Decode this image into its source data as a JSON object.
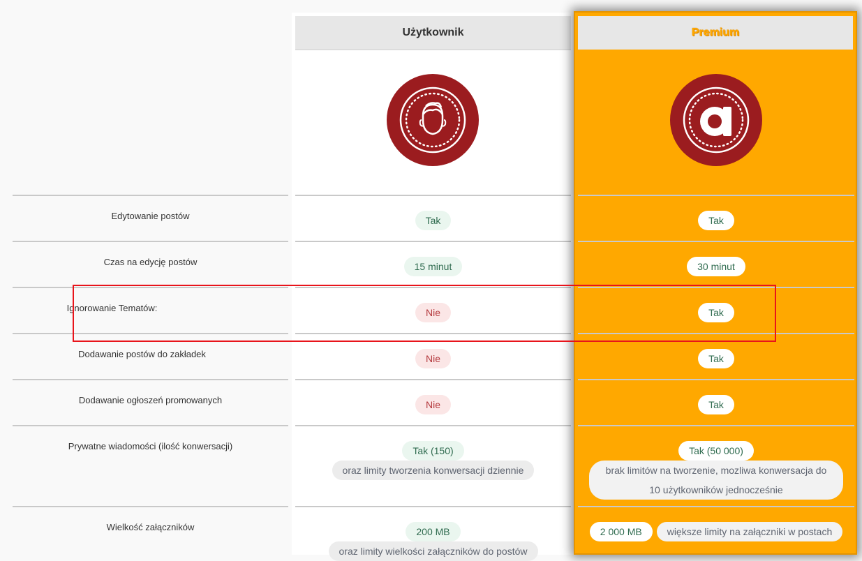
{
  "columns": {
    "user": {
      "title": "Użytkownik",
      "icon": "user-face-icon"
    },
    "premium": {
      "title": "Premium",
      "icon": "letter-a-icon"
    }
  },
  "colors": {
    "premium_bg": "#ffa800",
    "badge_red": "#9b1c1f",
    "yes_text": "#2f6b4f",
    "no_text": "#b4383c",
    "highlight_border": "#e8141b"
  },
  "rows": [
    {
      "label": "Edytowanie postów",
      "user": "Tak",
      "premium": "Tak"
    },
    {
      "label": "Czas na edycję postów",
      "user": "15 minut",
      "premium": "30 minut"
    },
    {
      "label": "Ignorowanie Tematów:",
      "user": "Nie",
      "premium": "Tak"
    },
    {
      "label": "Dodawanie postów do zakładek",
      "user": "Nie",
      "premium": "Tak"
    },
    {
      "label": "Dodawanie ogłoszeń promowanych",
      "user": "Nie",
      "premium": "Tak"
    },
    {
      "label": "Prywatne wiadomości (ilość konwersacji)",
      "user": "Tak (150)",
      "user_note": "oraz limity tworzenia konwersacji dziennie",
      "premium": "Tak (50 000)",
      "premium_note": "brak limitów na tworzenie, mozliwa konwersacja do 10 użytkowników jednocześnie"
    },
    {
      "label": "Wielkość załączników",
      "user": "200 MB",
      "user_note": "oraz limity wielkości załączników do postów",
      "premium": "2 000 MB",
      "premium_note": "większe limity na załączniki w postach"
    }
  ]
}
